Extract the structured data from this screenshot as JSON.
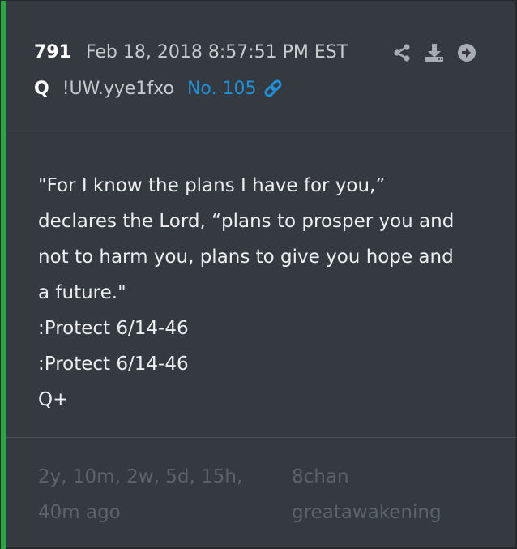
{
  "colors": {
    "accent_bar": "#28a745",
    "card_bg": "#343a40",
    "link": "#1e90d6",
    "icon": "#a9adb1"
  },
  "header": {
    "post_number": "791",
    "date": "Feb 18, 2018 8:57:51 PM EST",
    "author": "Q",
    "tripcode": "!UW.yye1fxo",
    "post_link": "No. 105",
    "icons": [
      "share-icon",
      "download-icon",
      "arrow-circle-right-icon",
      "link-icon"
    ]
  },
  "body": {
    "lines": [
      "\"For I know the plans I have for you,”",
      "declares the Lord, “plans to prosper you and",
      "not to harm you, plans to give you hope and",
      "a future.\"",
      ":Protect 6/14-46",
      ":Protect 6/14-46",
      "Q+"
    ]
  },
  "footer": {
    "time_ago_lines": [
      "2y, 10m, 2w, 5d, 15h,",
      "40m ago"
    ],
    "source_lines": [
      "8chan",
      "greatawakening"
    ]
  }
}
